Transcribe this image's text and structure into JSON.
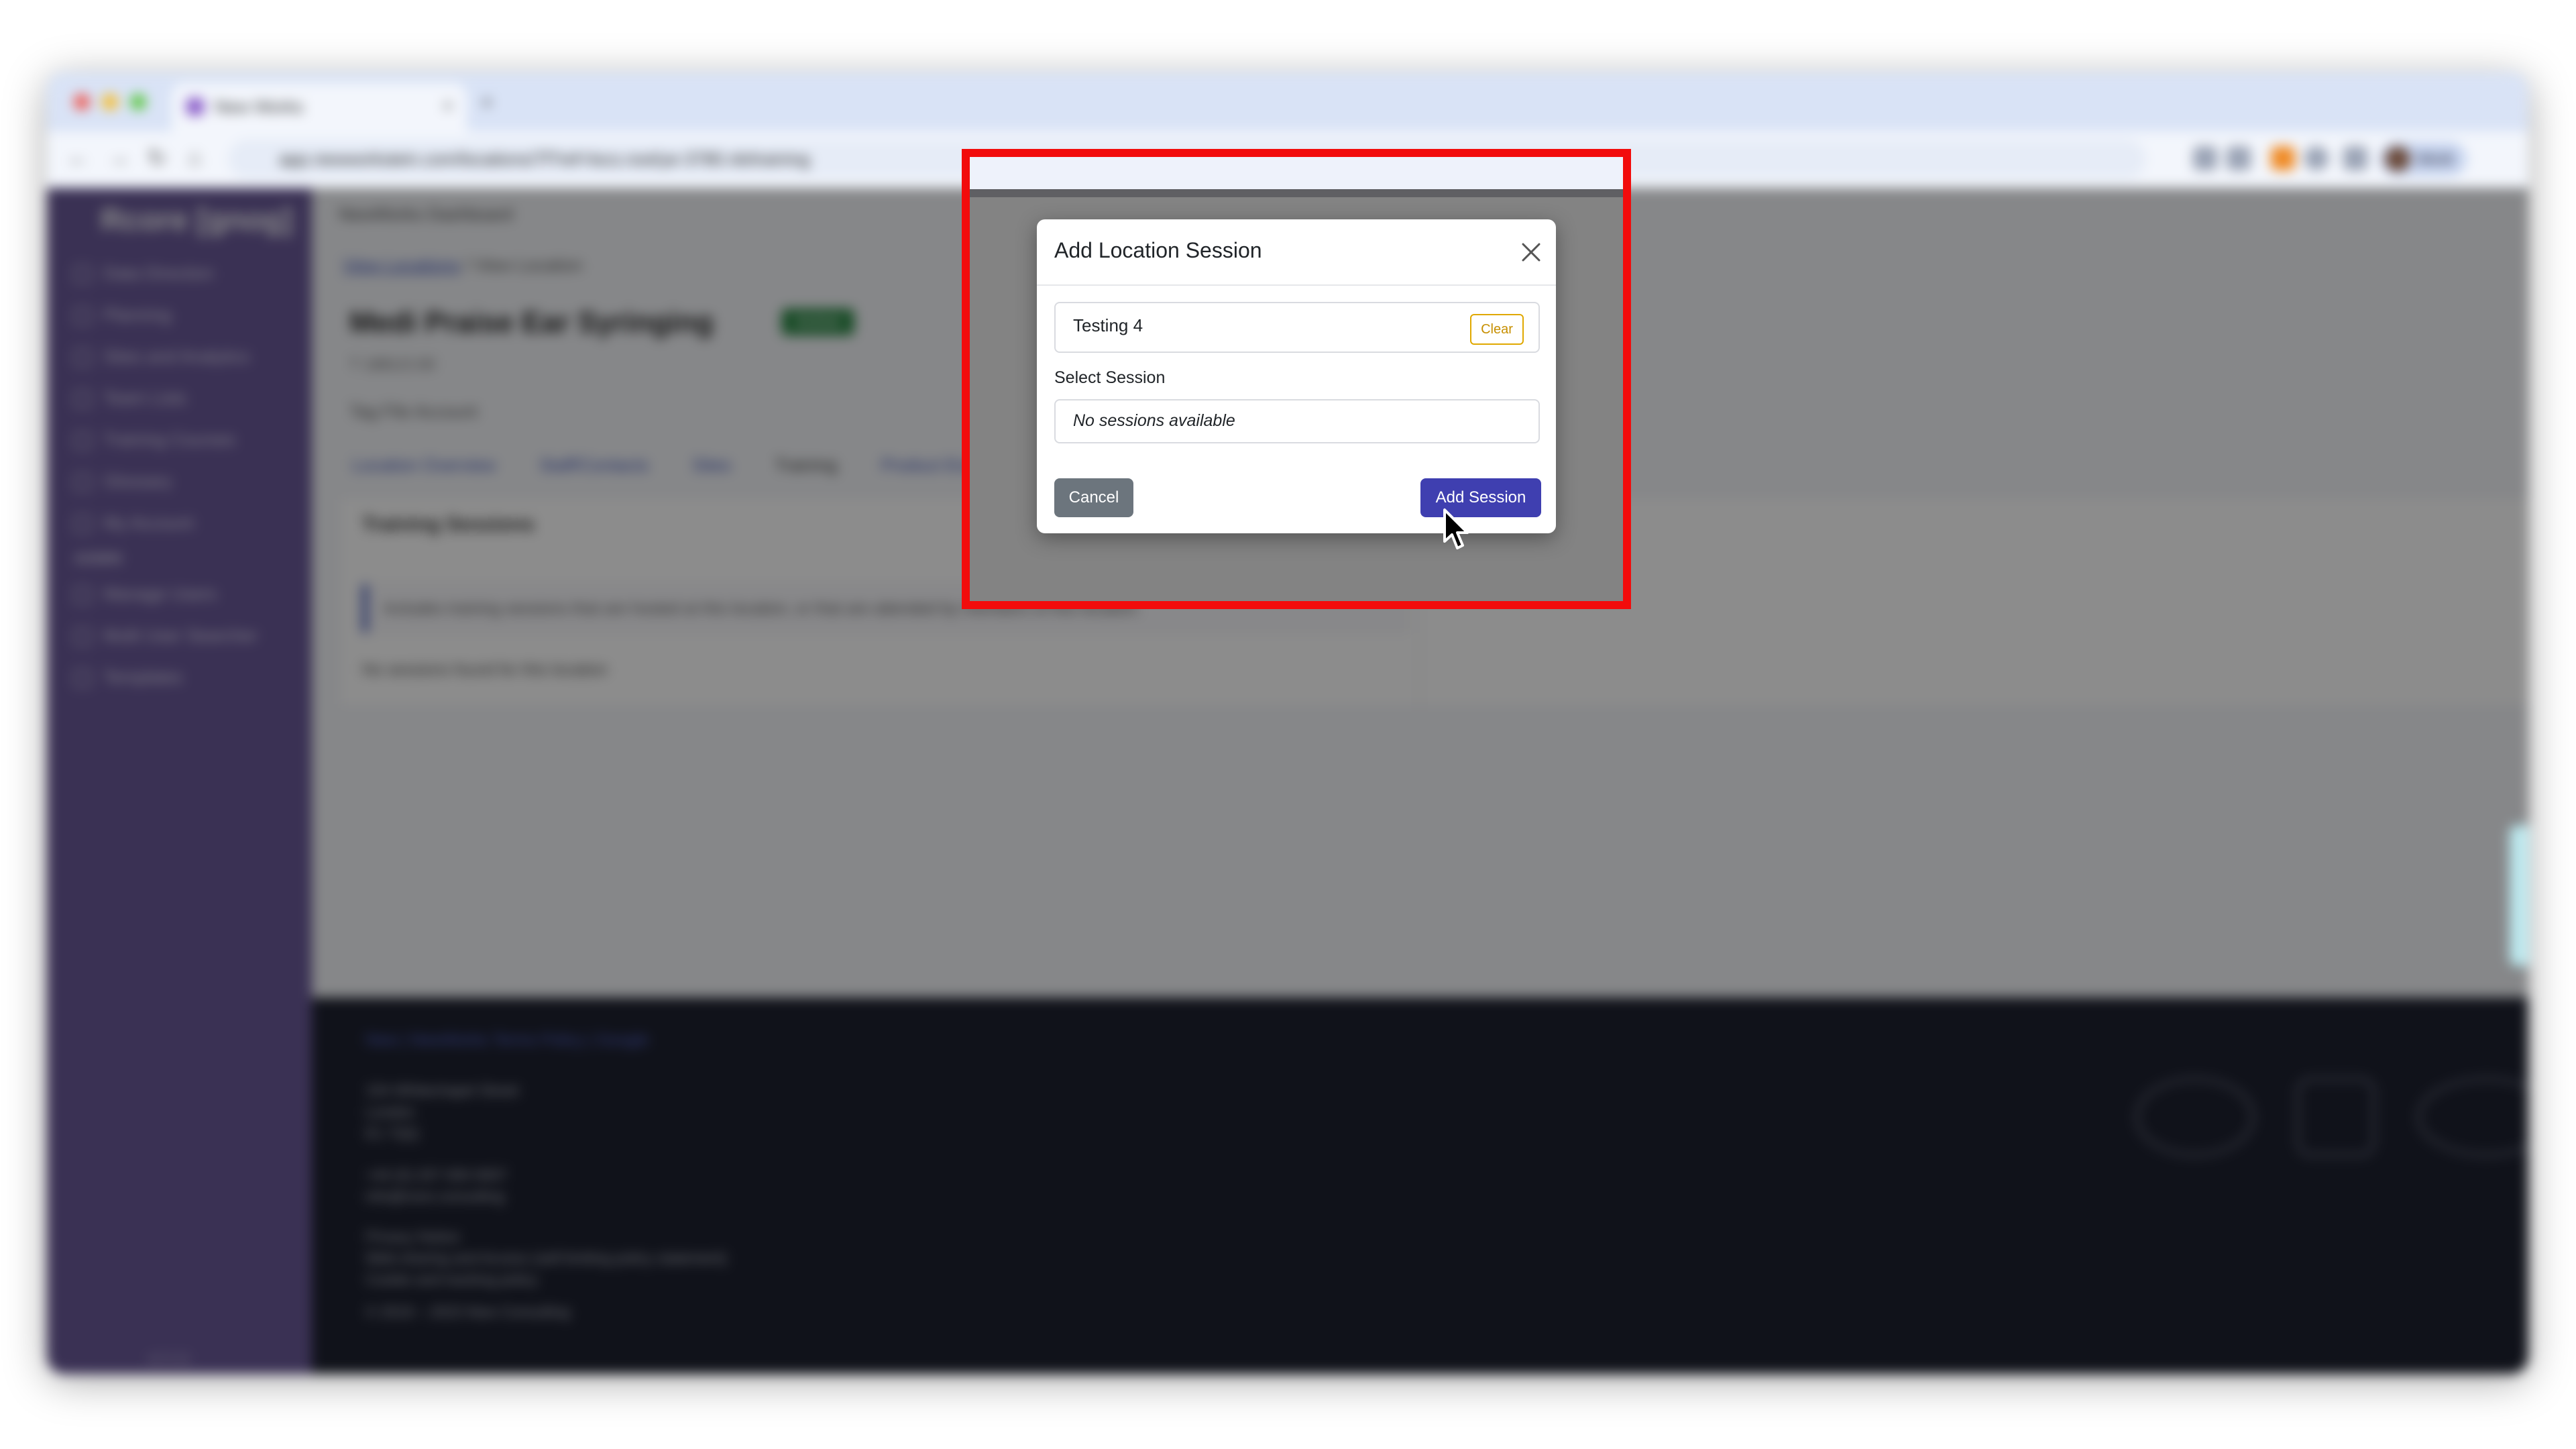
{
  "browser": {
    "tab_title": "New Works",
    "tab_close": "×",
    "new_tab": "+",
    "url": "app.newworkstein.com/locations/7f?ref=locs.root/ye-3780.nb/training",
    "profile_name": "Work"
  },
  "sidebar": {
    "logo": "Rcore [gnog]",
    "items": [
      "Data Direction",
      "Planning",
      "Sites and Analytics",
      "Team Lists",
      "Training Courses",
      "Glossary",
      "My Account"
    ],
    "section_label": "ADMIN",
    "admin_items": [
      "Manage Users",
      "Multi User Searcher",
      "Templates"
    ],
    "footer": "v2.3.11"
  },
  "main": {
    "topbar_title": "NewWorks Dashboard",
    "breadcrumb_link": "View Locations",
    "breadcrumb_sep": "/",
    "breadcrumb_current": "View Location",
    "page_title": "Medi Praise Ear Syringing",
    "status": "Active",
    "subline": "T 1881/2.00",
    "tag_line": "Tag File Account",
    "tabs": [
      "Location Overview",
      "Staff/Contacts",
      "Sites",
      "Training",
      "Product Engagement"
    ],
    "card_title": "Training Sessions",
    "card_info": "Includes training sessions that are hosted at this location, or that are attended by members of this location.",
    "card_empty": "No sessions found for this location"
  },
  "footer": {
    "link": "New | NewWorks Terms Policy | Google",
    "address_lines": [
      "154 Whitechapel Street",
      "London",
      "E1 7QQ"
    ],
    "contact_lines": [
      "+44 (0) 207 000 0007",
      "info@nore.consulting"
    ],
    "legal_lines": [
      "Privacy Notice",
      "Web-sharing and Access (self-limiting policy statement)",
      "Cookie and tracking policy",
      "© 2019 – 2023 New Consulting"
    ]
  },
  "modal": {
    "title": "Add Location Session",
    "search_value": "Testing 4",
    "clear_label": "Clear",
    "select_label": "Select Session",
    "select_value": "No sessions available",
    "cancel_label": "Cancel",
    "add_label": "Add Session"
  },
  "colors": {
    "highlight": "#f20c0c",
    "primary": "#3f3fb0",
    "secondary": "#6c757d",
    "warning": "#e0a800"
  }
}
